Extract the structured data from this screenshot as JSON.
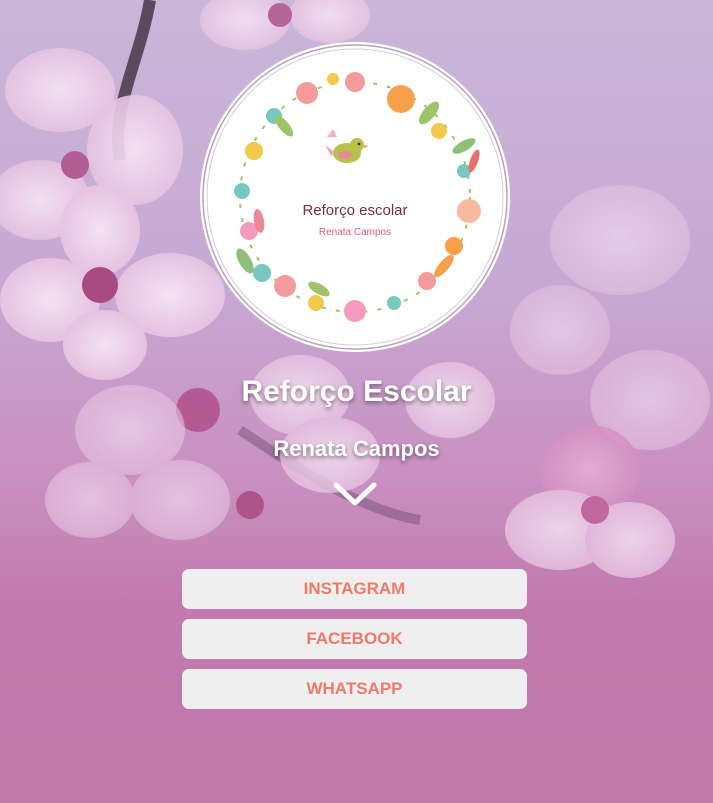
{
  "logo": {
    "title": "Reforço escolar",
    "subtitle": "Renata Campos"
  },
  "profile": {
    "title": "Reforço Escolar",
    "name": "Renata Campos"
  },
  "links": [
    {
      "label": "INSTAGRAM"
    },
    {
      "label": "FACEBOOK"
    },
    {
      "label": "WHATSAPP"
    }
  ],
  "colors": {
    "button_bg": "#efefef",
    "button_text": "#f07a6a",
    "background_bottom": "#c077aa"
  },
  "icons": {
    "scroll": "chevron-down-icon"
  }
}
